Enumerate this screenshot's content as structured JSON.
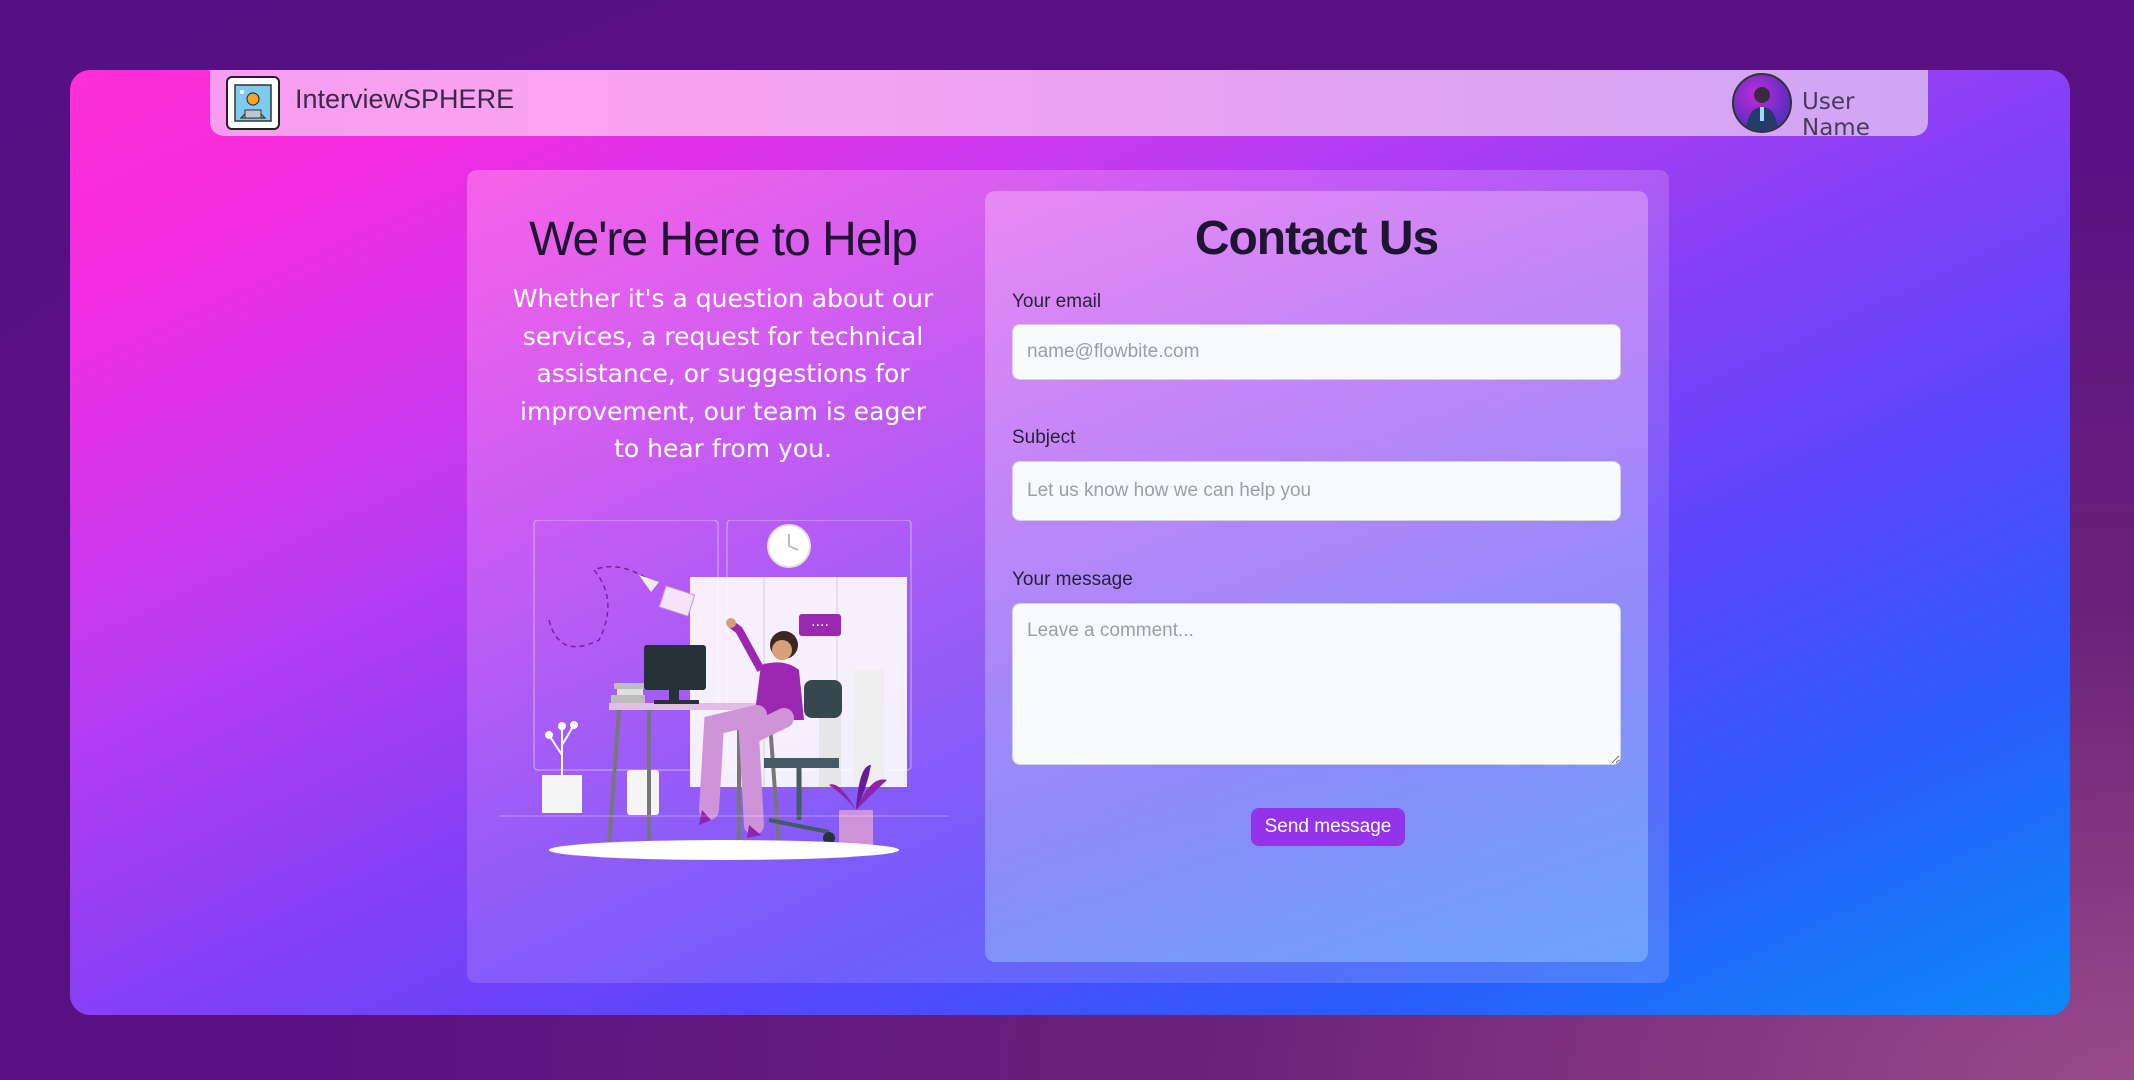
{
  "navbar": {
    "brand": "InterviewSPHERE",
    "user_name": "User Name"
  },
  "help": {
    "title": "We're Here to Help",
    "text": "Whether it's a question about our services, a request for technical assistance, or suggestions for improvement, our team is eager to hear from you.",
    "illustration_icon": "customer-support-illustration"
  },
  "contact": {
    "title": "Contact Us",
    "email_label": "Your email",
    "email_placeholder": "name@flowbite.com",
    "subject_label": "Subject",
    "subject_placeholder": "Let us know how we can help you",
    "message_label": "Your message",
    "message_placeholder": "Leave a comment...",
    "send_label": "Send message"
  },
  "colors": {
    "accent": "#9333ea",
    "title_text": "#1e1530"
  }
}
